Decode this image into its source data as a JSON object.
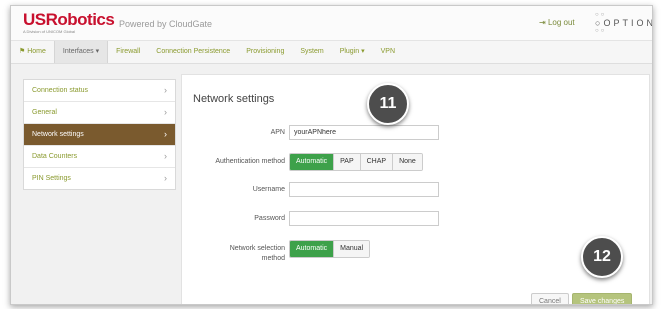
{
  "header": {
    "brand": "USRobotics",
    "brand_tagline": "A Division of UNICOM Global",
    "powered_by": "Powered by CloudGate",
    "logout": "Log out",
    "logout_icon": "logout-icon",
    "partner_logo": "OPTION"
  },
  "menu": {
    "items": [
      {
        "label": "Home",
        "icon": "home-icon"
      },
      {
        "label": "Interfaces"
      },
      {
        "label": "Firewall"
      },
      {
        "label": "Connection Persistence"
      },
      {
        "label": "Provisioning"
      },
      {
        "label": "System"
      },
      {
        "label": "Plugin"
      },
      {
        "label": "VPN"
      }
    ],
    "active": "Interfaces"
  },
  "sidebar": {
    "items": [
      {
        "label": "Connection status"
      },
      {
        "label": "General"
      },
      {
        "label": "Network settings"
      },
      {
        "label": "Data Counters"
      },
      {
        "label": "PIN Settings"
      }
    ],
    "active": "Network settings"
  },
  "main": {
    "title": "Network settings",
    "apn": {
      "label": "APN",
      "value": "yourAPNhere"
    },
    "auth": {
      "label": "Authentication method",
      "options": [
        "Automatic",
        "PAP",
        "CHAP",
        "None"
      ],
      "selected": "Automatic"
    },
    "username": {
      "label": "Username",
      "value": ""
    },
    "password": {
      "label": "Password",
      "value": ""
    },
    "network_selection": {
      "label_line1": "Network selection",
      "label_line2": "method",
      "options": [
        "Automatic",
        "Manual"
      ],
      "selected": "Automatic"
    },
    "cancel": "Cancel",
    "save": "Save changes"
  },
  "badges": [
    "11",
    "12"
  ],
  "colors": {
    "brand_red": "#c8102e",
    "link_green": "#8a9a2e",
    "active_brown": "#7a5a2e",
    "toggle_green": "#3da14a",
    "save_disabled": "#b5c47d",
    "badge_gray": "#4d4d4d"
  }
}
